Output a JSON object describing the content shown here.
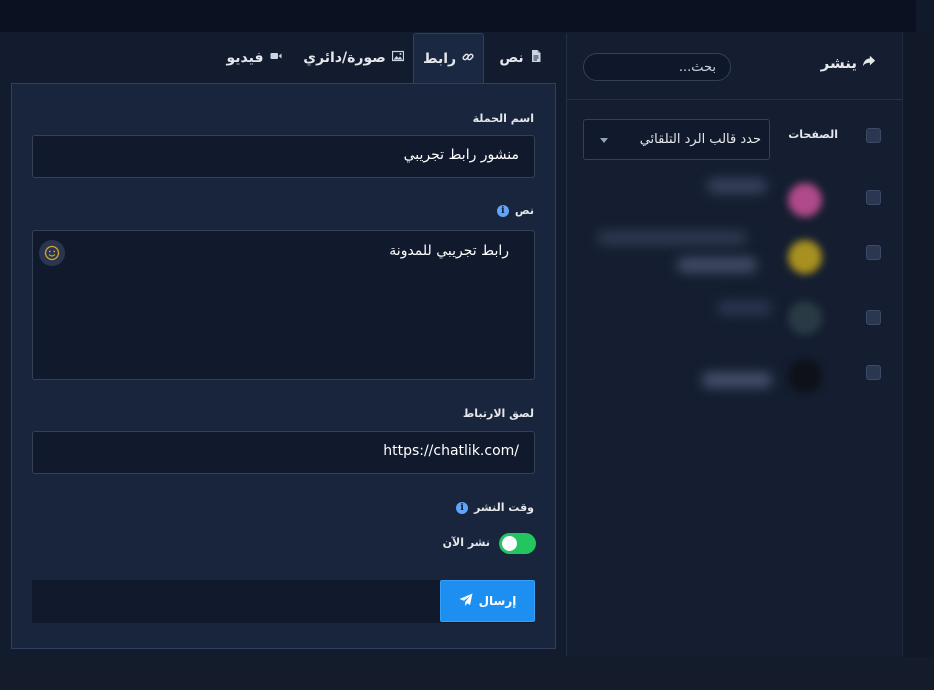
{
  "publish_panel": {
    "title": "ينشر",
    "search_placeholder": "بحث...",
    "pages_label": "الصفحات",
    "reply_template_select": "حدد قالب الرد التلقائي"
  },
  "tabs": [
    {
      "label": "نص",
      "icon": "file-text-icon",
      "active": false
    },
    {
      "label": "رابط",
      "icon": "link-icon",
      "active": true
    },
    {
      "label": "صورة/دائري",
      "icon": "image-icon",
      "active": false
    },
    {
      "label": "فيديو",
      "icon": "video-icon",
      "active": false
    }
  ],
  "form": {
    "campaign_name_label": "اسم الحملة",
    "campaign_name_value": "منشور رابط تجريبي",
    "text_label": "نص",
    "text_value": "رابط تجريبي للمدونة",
    "link_label": "لصق الارتباط",
    "link_value": "https://chatlik.com/",
    "publish_time_label": "وقت النشر",
    "publish_now_label": "نشر الآن",
    "publish_now_enabled": true,
    "send_label": "إرسال"
  },
  "colors": {
    "accent_blue": "#1d8ff0",
    "toggle_green": "#22c55e",
    "info_blue": "#60a5fa"
  }
}
